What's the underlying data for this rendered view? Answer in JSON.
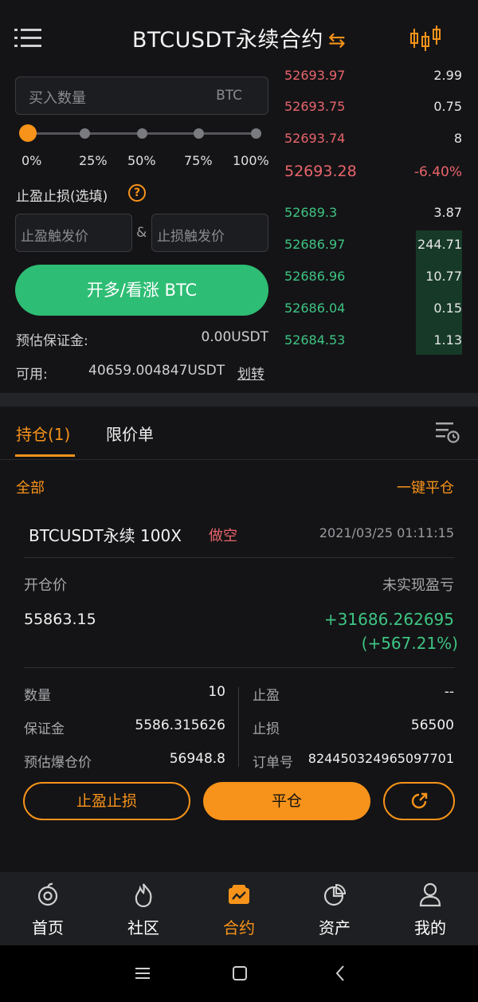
{
  "header": {
    "title": "BTCUSDT永续合约",
    "swap_glyph": "⇆",
    "icons": [
      "menu-icon",
      "kline-chart-icon"
    ]
  },
  "order_form": {
    "qty_placeholder": "买入数量",
    "qty_unit": "BTC",
    "slider_value_percent": 0,
    "slider_marks": [
      "0%",
      "25%",
      "50%",
      "75%",
      "100%"
    ],
    "tpsl_label": "止盈止损(选填)",
    "help_glyph": "?",
    "tp_trigger_placeholder": "止盈触发价",
    "amp": "&",
    "sl_trigger_placeholder": "止损触发价",
    "open_long_label": "开多/看涨 BTC",
    "margin_label": "预估保证金:",
    "margin_value": "0.00USDT",
    "available_label": "可用:",
    "available_value": "40659.004847USDT",
    "transfer_label": "划转"
  },
  "orderbook": {
    "asks": [
      {
        "price": "52693.97",
        "qty": "2.99"
      },
      {
        "price": "52693.75",
        "qty": "0.75"
      },
      {
        "price": "52693.74",
        "qty": "8"
      }
    ],
    "last_price": "52693.28",
    "change": "-6.40%",
    "bids": [
      {
        "price": "52689.3",
        "qty": "3.87"
      },
      {
        "price": "52686.97",
        "qty": "244.71"
      },
      {
        "price": "52686.96",
        "qty": "10.77"
      },
      {
        "price": "52686.04",
        "qty": "0.15"
      },
      {
        "price": "52684.53",
        "qty": "1.13"
      }
    ]
  },
  "tabs": {
    "positions": "持仓(1)",
    "limit_orders": "限价单",
    "all": "全部",
    "close_all": "一键平仓"
  },
  "position": {
    "name": "BTCUSDT永续 100X",
    "side": "做空",
    "time": "2021/03/25 01:11:15",
    "entry_label": "开仓价",
    "entry_value": "55863.15",
    "pnl_label": "未实现盈亏",
    "pnl_value": "+31686.262695",
    "pnl_percent": "(+567.21%)",
    "qty_label": "数量",
    "qty_value": "10",
    "margin_label": "保证金",
    "margin_value": "5586.315626",
    "liq_label": "预估爆仓价",
    "liq_value": "56948.8",
    "tp_label": "止盈",
    "tp_value": "--",
    "sl_label": "止损",
    "sl_value": "56500",
    "order_label": "订单号",
    "order_value": "824450324965097701",
    "btn_tpsl": "止盈止损",
    "btn_close": "平仓"
  },
  "bottom_nav": [
    {
      "label": "首页",
      "icon": "home-icon"
    },
    {
      "label": "社区",
      "icon": "flame-icon"
    },
    {
      "label": "合约",
      "icon": "contract-icon",
      "active": true
    },
    {
      "label": "资产",
      "icon": "pie-chart-icon"
    },
    {
      "label": "我的",
      "icon": "user-icon"
    }
  ],
  "colors": {
    "accent": "#f7931a",
    "buy": "#2ebd74",
    "sell": "#e8646b",
    "background": "#141416"
  }
}
